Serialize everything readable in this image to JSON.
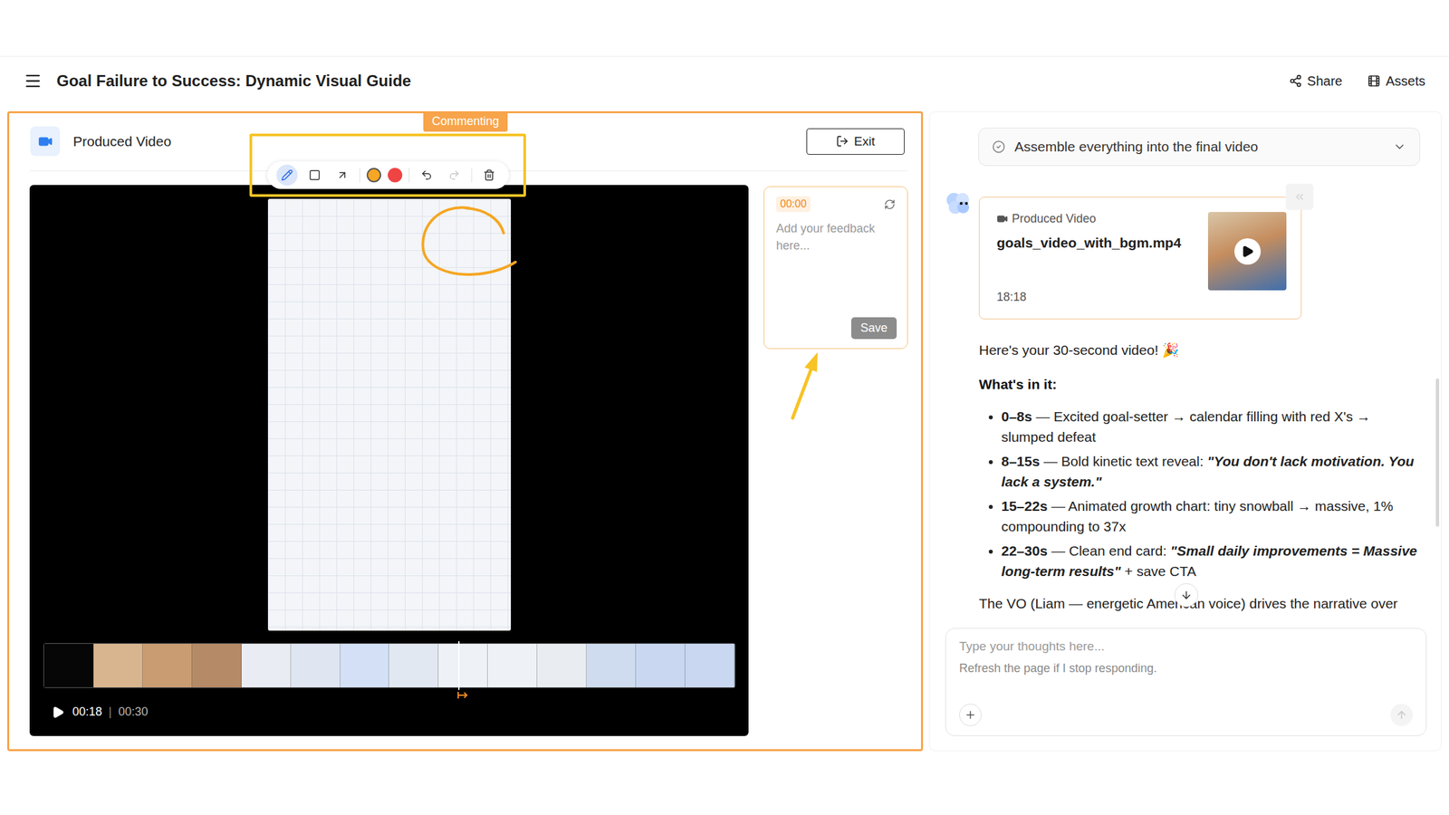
{
  "header": {
    "title": "Goal Failure to Success: Dynamic Visual Guide",
    "actions": [
      {
        "kind": "share",
        "label": "Share"
      },
      {
        "kind": "assets",
        "label": "Assets"
      }
    ]
  },
  "editor": {
    "title": "Produced Video",
    "mode_badge": "Commenting",
    "exit": "Exit",
    "tools": [
      {
        "kind": "pen",
        "selected": true
      },
      {
        "kind": "rectangle",
        "selected": false
      },
      {
        "kind": "arrow",
        "selected": false
      }
    ],
    "colors": [
      {
        "color": "#f5a623",
        "selected": true
      },
      {
        "color": "#ef4444",
        "selected": false
      }
    ],
    "history": [
      {
        "kind": "undo",
        "disabled": false
      },
      {
        "kind": "redo",
        "disabled": true
      }
    ],
    "player": {
      "current": "00:18",
      "separator": "|",
      "duration": "00:30",
      "level": 0.6,
      "playing": false
    },
    "comment": {
      "timestamp": "00:00",
      "placeholder": "Add your feedback here...",
      "save": "Save",
      "save_disabled": true
    }
  },
  "chat": {
    "step": {
      "label": "Assemble everything into the final video",
      "done": true,
      "expanded": false
    },
    "attachment": {
      "kind_label": "Produced Video",
      "filename": "goals_video_with_bgm.mp4",
      "duration": "18:18"
    },
    "intro": "Here's your 30-second video! 🎉",
    "list_title": "What's in it:",
    "items": [
      {
        "time": "0–8s",
        "text": " — Excited goal-setter → calendar filling with red X's → slumped defeat",
        "quote": "",
        "after": ""
      },
      {
        "time": "8–15s",
        "text": " — Bold kinetic text reveal: ",
        "quote": "\"You don't lack motivation. You lack a system.\"",
        "after": ""
      },
      {
        "time": "15–22s",
        "text": " — Animated growth chart: tiny snowball → massive, 1% compounding to 37x",
        "quote": "",
        "after": ""
      },
      {
        "time": "22–30s",
        "text": " — Clean end card: ",
        "quote": "\"Small daily improvements = Massive long-term results\"",
        "after": " + save CTA"
      }
    ],
    "footer_line": "The VO (Liam — energetic American voice) drives the narrative over",
    "input": {
      "placeholder": "Type your thoughts here...",
      "hint": "Refresh the page if I stop responding."
    }
  }
}
